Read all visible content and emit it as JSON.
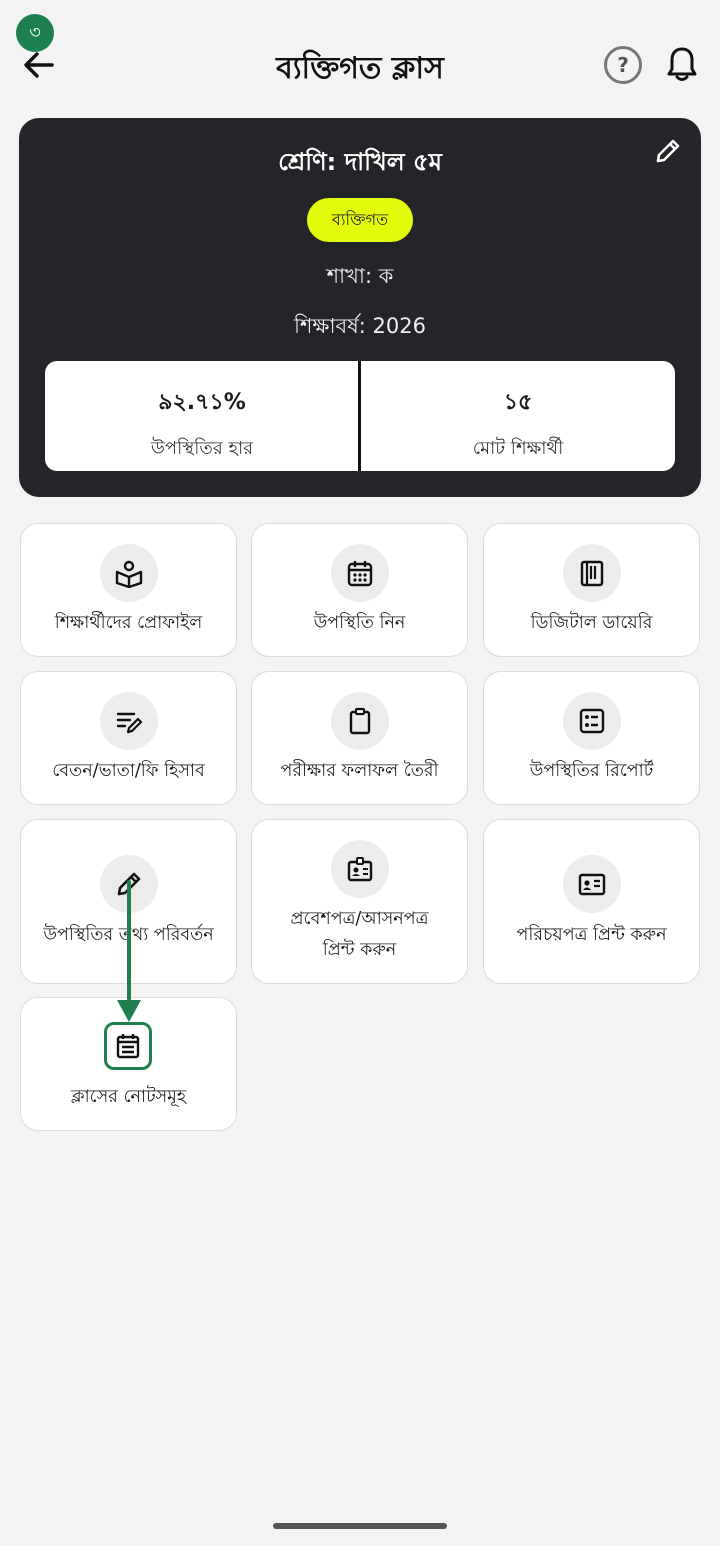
{
  "step_badge": "৩",
  "header": {
    "title": "ব্যক্তিগত ক্লাস",
    "help_glyph": "?"
  },
  "class_card": {
    "class_name": "শ্রেণি: দাখিল ৫ম",
    "type_badge": "ব্যক্তিগত",
    "section": "শাখা: ক",
    "academic_year": "শিক্ষাবর্ষ: 2026",
    "stats": {
      "attendance_rate": {
        "value": "৯২.৭১%",
        "label": "উপস্থিতির হার"
      },
      "total_students": {
        "value": "১৫",
        "label": "মোট শিক্ষার্থী"
      }
    }
  },
  "tiles": [
    {
      "label": "শিক্ষার্থীদের প্রোফাইল",
      "icon": "book-user-icon"
    },
    {
      "label": "উপস্থিতি নিন",
      "icon": "calendar-grid-icon"
    },
    {
      "label": "ডিজিটাল ডায়েরি",
      "icon": "book-icon"
    },
    {
      "label": "বেতন/ভাতা/ফি হিসাব",
      "icon": "edit-lines-icon"
    },
    {
      "label": "পরীক্ষার ফলাফল তৈরী",
      "icon": "clipboard-icon"
    },
    {
      "label": "উপস্থিতির রিপোর্ট",
      "icon": "list-report-icon"
    },
    {
      "label": "উপস্থিতির তথ্য পরিবর্তন",
      "icon": "pencil-icon"
    },
    {
      "label": "প্রবেশপত্র/আসনপত্র প্রিন্ট করুন",
      "icon": "id-badge-icon"
    },
    {
      "label": "পরিচয়পত্র প্রিন্ট করুন",
      "icon": "id-card-icon"
    },
    {
      "label": "ক্লাসের নোটসমূহ",
      "icon": "notes-calendar-icon"
    }
  ],
  "colors": {
    "accent_green": "#1e7f4f",
    "badge_yellow": "#e2fa0c",
    "card_dark": "#232528",
    "background": "#f3f3f3"
  }
}
